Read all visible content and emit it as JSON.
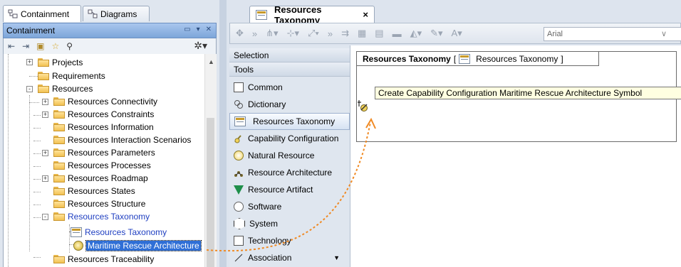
{
  "left_tabs": [
    {
      "label": "Containment",
      "icon": "containment-icon",
      "active": true
    },
    {
      "label": "Diagrams",
      "icon": "diagrams-icon",
      "active": false
    }
  ],
  "panel": {
    "title": "Containment"
  },
  "tree": {
    "items": [
      {
        "label": "Projects",
        "expand": "+"
      },
      {
        "label": "Requirements",
        "expand": ""
      },
      {
        "label": "Resources",
        "expand": "-"
      },
      {
        "label": "Resources Connectivity",
        "expand": "+"
      },
      {
        "label": "Resources Constraints",
        "expand": "+"
      },
      {
        "label": "Resources Information",
        "expand": ""
      },
      {
        "label": "Resources Interaction Scenarios",
        "expand": ""
      },
      {
        "label": "Resources Parameters",
        "expand": "+"
      },
      {
        "label": "Resources Processes",
        "expand": ""
      },
      {
        "label": "Resources Roadmap",
        "expand": "+"
      },
      {
        "label": "Resources States",
        "expand": ""
      },
      {
        "label": "Resources Structure",
        "expand": ""
      },
      {
        "label": "Resources Taxonomy",
        "expand": "-"
      },
      {
        "label": "Resources Taxonomy",
        "expand": ""
      },
      {
        "label": "Maritime Rescue Architecture",
        "expand": ""
      },
      {
        "label": "Resources Traceability",
        "expand": ""
      }
    ]
  },
  "document_tab": {
    "title": "Resources Taxonomy",
    "close": "×"
  },
  "toolbar": {
    "font": "Arial"
  },
  "palette": {
    "groups": [
      "Selection",
      "Tools"
    ],
    "items": [
      {
        "label": "Common",
        "icon": "common-icon"
      },
      {
        "label": "Dictionary",
        "icon": "dictionary-icon"
      },
      {
        "label": "Resources Taxonomy",
        "icon": "diagram-icon"
      },
      {
        "label": "Capability Configuration",
        "icon": "capability-configuration-icon"
      },
      {
        "label": "Natural Resource",
        "icon": "natural-resource-icon"
      },
      {
        "label": "Resource Architecture",
        "icon": "resource-architecture-icon"
      },
      {
        "label": "Resource Artifact",
        "icon": "resource-artifact-icon"
      },
      {
        "label": "Software",
        "icon": "software-icon"
      },
      {
        "label": "System",
        "icon": "system-icon"
      },
      {
        "label": "Technology",
        "icon": "technology-icon"
      },
      {
        "label": "Association",
        "icon": "association-icon"
      }
    ]
  },
  "diagram": {
    "frame_title": "Resources Taxonomy",
    "frame_bracket_open": "[",
    "frame_bracket_close": "]",
    "frame_ref": "Resources Taxonomy",
    "tooltip": "Create Capability Configuration Maritime Rescue Architecture Symbol"
  },
  "colors": {
    "selection": "#2f6fd6",
    "arrow": "#f08a24",
    "link_text": "#1f3fc1"
  }
}
